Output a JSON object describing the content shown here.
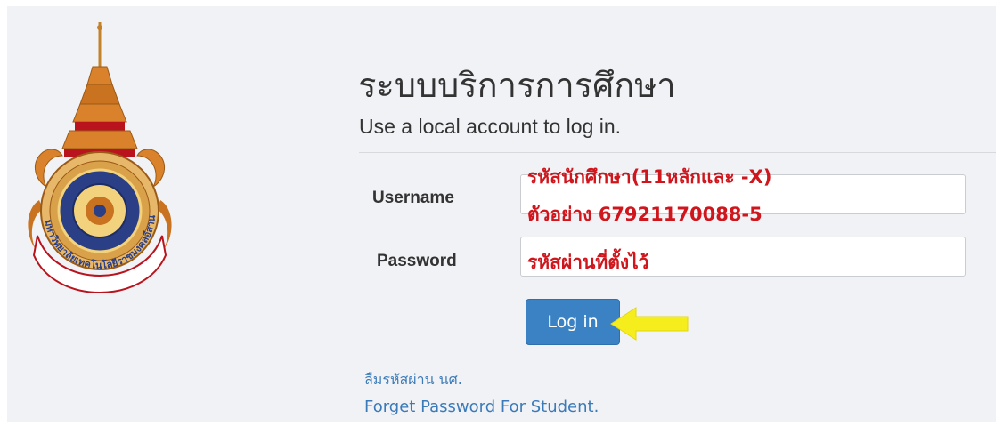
{
  "header": {
    "title": "ระบบบริการการศึกษา",
    "subtitle": "Use a local account to log in."
  },
  "form": {
    "username_label": "Username",
    "password_label": "Password",
    "username_hint_line1": "รหัสนักศึกษา(11หลักและ -X)",
    "username_hint_line2": "ตัวอย่าง  67921170088-5",
    "password_hint": "รหัสผ่านที่ตั้งไว้",
    "login_label": "Log in"
  },
  "links": {
    "forgot_th": "ลืมรหัสผ่าน นศ.",
    "forgot_en": "Forget Password For Student."
  },
  "logo": {
    "seal_text": "มหาวิทยาลัยเทคโนโลยีราชมงคลอีสาน"
  },
  "colors": {
    "background": "#f1f2f5",
    "button": "#3b82c4",
    "link": "#3a7ab8",
    "hint": "#d0161d",
    "arrow": "#f6ee1c"
  }
}
